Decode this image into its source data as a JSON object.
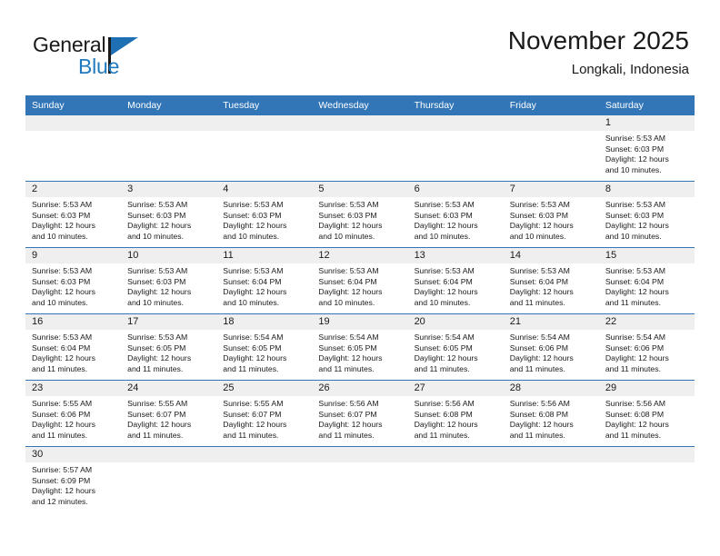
{
  "brand": {
    "logo_text_primary": "General",
    "logo_text_secondary": "Blue",
    "logo_icon": "flag-triangle-icon",
    "accent_color": "#3276b8",
    "logo_blue": "#1f7ac0"
  },
  "header": {
    "title": "November 2025",
    "subtitle": "Longkali, Indonesia"
  },
  "calendar": {
    "weekday_headers": [
      "Sunday",
      "Monday",
      "Tuesday",
      "Wednesday",
      "Thursday",
      "Friday",
      "Saturday"
    ],
    "labels": {
      "sunrise": "Sunrise:",
      "sunset": "Sunset:",
      "daylight": "Daylight:"
    },
    "weeks": [
      [
        {
          "day": "",
          "empty": true
        },
        {
          "day": "",
          "empty": true
        },
        {
          "day": "",
          "empty": true
        },
        {
          "day": "",
          "empty": true
        },
        {
          "day": "",
          "empty": true
        },
        {
          "day": "",
          "empty": true
        },
        {
          "day": "1",
          "sunrise": "Sunrise: 5:53 AM",
          "sunset": "Sunset: 6:03 PM",
          "daylight1": "Daylight: 12 hours",
          "daylight2": "and 10 minutes."
        }
      ],
      [
        {
          "day": "2",
          "sunrise": "Sunrise: 5:53 AM",
          "sunset": "Sunset: 6:03 PM",
          "daylight1": "Daylight: 12 hours",
          "daylight2": "and 10 minutes."
        },
        {
          "day": "3",
          "sunrise": "Sunrise: 5:53 AM",
          "sunset": "Sunset: 6:03 PM",
          "daylight1": "Daylight: 12 hours",
          "daylight2": "and 10 minutes."
        },
        {
          "day": "4",
          "sunrise": "Sunrise: 5:53 AM",
          "sunset": "Sunset: 6:03 PM",
          "daylight1": "Daylight: 12 hours",
          "daylight2": "and 10 minutes."
        },
        {
          "day": "5",
          "sunrise": "Sunrise: 5:53 AM",
          "sunset": "Sunset: 6:03 PM",
          "daylight1": "Daylight: 12 hours",
          "daylight2": "and 10 minutes."
        },
        {
          "day": "6",
          "sunrise": "Sunrise: 5:53 AM",
          "sunset": "Sunset: 6:03 PM",
          "daylight1": "Daylight: 12 hours",
          "daylight2": "and 10 minutes."
        },
        {
          "day": "7",
          "sunrise": "Sunrise: 5:53 AM",
          "sunset": "Sunset: 6:03 PM",
          "daylight1": "Daylight: 12 hours",
          "daylight2": "and 10 minutes."
        },
        {
          "day": "8",
          "sunrise": "Sunrise: 5:53 AM",
          "sunset": "Sunset: 6:03 PM",
          "daylight1": "Daylight: 12 hours",
          "daylight2": "and 10 minutes."
        }
      ],
      [
        {
          "day": "9",
          "sunrise": "Sunrise: 5:53 AM",
          "sunset": "Sunset: 6:03 PM",
          "daylight1": "Daylight: 12 hours",
          "daylight2": "and 10 minutes."
        },
        {
          "day": "10",
          "sunrise": "Sunrise: 5:53 AM",
          "sunset": "Sunset: 6:03 PM",
          "daylight1": "Daylight: 12 hours",
          "daylight2": "and 10 minutes."
        },
        {
          "day": "11",
          "sunrise": "Sunrise: 5:53 AM",
          "sunset": "Sunset: 6:04 PM",
          "daylight1": "Daylight: 12 hours",
          "daylight2": "and 10 minutes."
        },
        {
          "day": "12",
          "sunrise": "Sunrise: 5:53 AM",
          "sunset": "Sunset: 6:04 PM",
          "daylight1": "Daylight: 12 hours",
          "daylight2": "and 10 minutes."
        },
        {
          "day": "13",
          "sunrise": "Sunrise: 5:53 AM",
          "sunset": "Sunset: 6:04 PM",
          "daylight1": "Daylight: 12 hours",
          "daylight2": "and 10 minutes."
        },
        {
          "day": "14",
          "sunrise": "Sunrise: 5:53 AM",
          "sunset": "Sunset: 6:04 PM",
          "daylight1": "Daylight: 12 hours",
          "daylight2": "and 11 minutes."
        },
        {
          "day": "15",
          "sunrise": "Sunrise: 5:53 AM",
          "sunset": "Sunset: 6:04 PM",
          "daylight1": "Daylight: 12 hours",
          "daylight2": "and 11 minutes."
        }
      ],
      [
        {
          "day": "16",
          "sunrise": "Sunrise: 5:53 AM",
          "sunset": "Sunset: 6:04 PM",
          "daylight1": "Daylight: 12 hours",
          "daylight2": "and 11 minutes."
        },
        {
          "day": "17",
          "sunrise": "Sunrise: 5:53 AM",
          "sunset": "Sunset: 6:05 PM",
          "daylight1": "Daylight: 12 hours",
          "daylight2": "and 11 minutes."
        },
        {
          "day": "18",
          "sunrise": "Sunrise: 5:54 AM",
          "sunset": "Sunset: 6:05 PM",
          "daylight1": "Daylight: 12 hours",
          "daylight2": "and 11 minutes."
        },
        {
          "day": "19",
          "sunrise": "Sunrise: 5:54 AM",
          "sunset": "Sunset: 6:05 PM",
          "daylight1": "Daylight: 12 hours",
          "daylight2": "and 11 minutes."
        },
        {
          "day": "20",
          "sunrise": "Sunrise: 5:54 AM",
          "sunset": "Sunset: 6:05 PM",
          "daylight1": "Daylight: 12 hours",
          "daylight2": "and 11 minutes."
        },
        {
          "day": "21",
          "sunrise": "Sunrise: 5:54 AM",
          "sunset": "Sunset: 6:06 PM",
          "daylight1": "Daylight: 12 hours",
          "daylight2": "and 11 minutes."
        },
        {
          "day": "22",
          "sunrise": "Sunrise: 5:54 AM",
          "sunset": "Sunset: 6:06 PM",
          "daylight1": "Daylight: 12 hours",
          "daylight2": "and 11 minutes."
        }
      ],
      [
        {
          "day": "23",
          "sunrise": "Sunrise: 5:55 AM",
          "sunset": "Sunset: 6:06 PM",
          "daylight1": "Daylight: 12 hours",
          "daylight2": "and 11 minutes."
        },
        {
          "day": "24",
          "sunrise": "Sunrise: 5:55 AM",
          "sunset": "Sunset: 6:07 PM",
          "daylight1": "Daylight: 12 hours",
          "daylight2": "and 11 minutes."
        },
        {
          "day": "25",
          "sunrise": "Sunrise: 5:55 AM",
          "sunset": "Sunset: 6:07 PM",
          "daylight1": "Daylight: 12 hours",
          "daylight2": "and 11 minutes."
        },
        {
          "day": "26",
          "sunrise": "Sunrise: 5:56 AM",
          "sunset": "Sunset: 6:07 PM",
          "daylight1": "Daylight: 12 hours",
          "daylight2": "and 11 minutes."
        },
        {
          "day": "27",
          "sunrise": "Sunrise: 5:56 AM",
          "sunset": "Sunset: 6:08 PM",
          "daylight1": "Daylight: 12 hours",
          "daylight2": "and 11 minutes."
        },
        {
          "day": "28",
          "sunrise": "Sunrise: 5:56 AM",
          "sunset": "Sunset: 6:08 PM",
          "daylight1": "Daylight: 12 hours",
          "daylight2": "and 11 minutes."
        },
        {
          "day": "29",
          "sunrise": "Sunrise: 5:56 AM",
          "sunset": "Sunset: 6:08 PM",
          "daylight1": "Daylight: 12 hours",
          "daylight2": "and 11 minutes."
        }
      ],
      [
        {
          "day": "30",
          "sunrise": "Sunrise: 5:57 AM",
          "sunset": "Sunset: 6:09 PM",
          "daylight1": "Daylight: 12 hours",
          "daylight2": "and 12 minutes."
        },
        {
          "day": "",
          "empty": true
        },
        {
          "day": "",
          "empty": true
        },
        {
          "day": "",
          "empty": true
        },
        {
          "day": "",
          "empty": true
        },
        {
          "day": "",
          "empty": true
        },
        {
          "day": "",
          "empty": true
        }
      ]
    ]
  }
}
